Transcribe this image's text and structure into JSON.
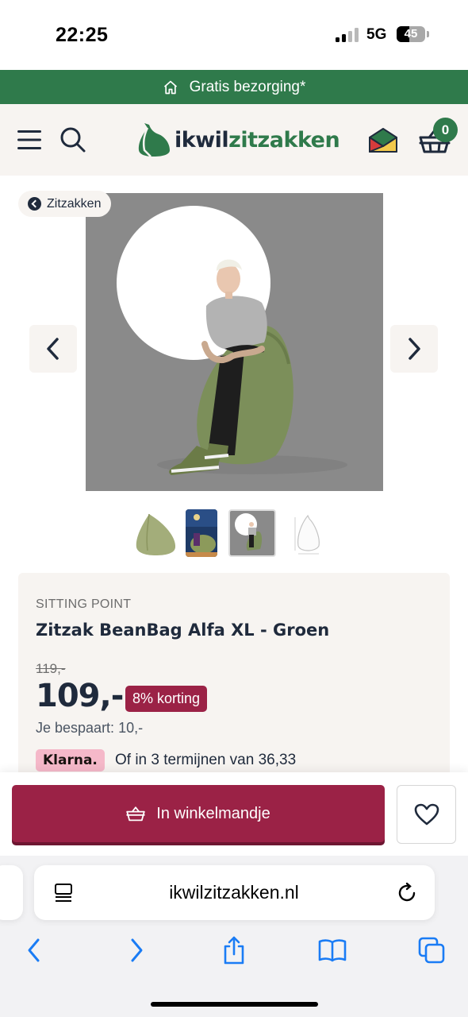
{
  "status_bar": {
    "time": "22:25",
    "network": "5G",
    "battery": "45",
    "battery_level": 0.45
  },
  "promo": {
    "text": "Gratis bezorging*",
    "icon": "home-icon"
  },
  "header": {
    "logo_part1": "ikwil",
    "logo_part2": "zitzakken",
    "cart_count": "0",
    "icons": [
      "menu-icon",
      "search-icon",
      "mail-icon",
      "basket-icon"
    ]
  },
  "breadcrumb": {
    "label": "Zitzakken"
  },
  "gallery": {
    "thumbnails": [
      "thumbnail-green-beanbag",
      "thumbnail-lifestyle",
      "thumbnail-person-seated",
      "thumbnail-dimensions-drawing"
    ],
    "active_index": 2
  },
  "product": {
    "brand": "SITTING POINT",
    "title": "Zitzak BeanBag Alfa XL - Groen",
    "old_price": "119,-",
    "price": "109,-",
    "discount": "8% korting",
    "savings": "Je bespaart: 10,-",
    "klarna_label": "Klarna.",
    "klarna_text": "Of in 3 termijnen van 36,33"
  },
  "actions": {
    "add_to_cart": "In winkelmandje"
  },
  "browser": {
    "url": "ikwilzitzakken.nl"
  },
  "colors": {
    "brand_green": "#2f7a4b",
    "accent_burgundy": "#9b2246",
    "navy": "#1f2a3c",
    "cream": "#f7f4f1",
    "klarna_pink": "#f5b8c9"
  }
}
